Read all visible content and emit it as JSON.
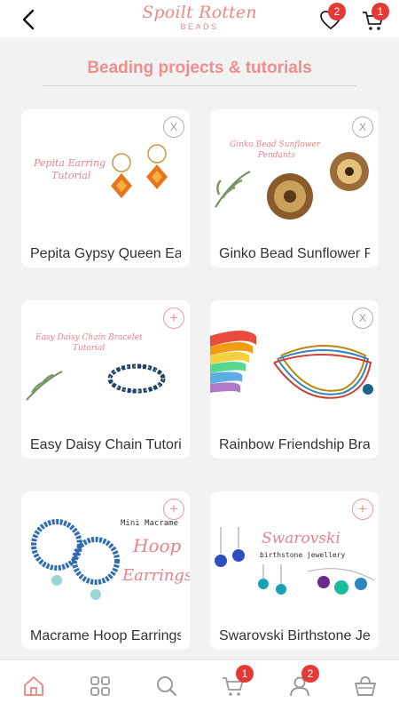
{
  "header": {
    "logo_line1": "Spoilt Rotten",
    "logo_line2": "BEADS",
    "wishlist_count": "2",
    "cart_count": "1"
  },
  "page_title": "Beading projects & tutorials",
  "cards": [
    {
      "name": "Pepita Gypsy Queen Earrings",
      "corner": "X",
      "img_text": [
        "Pepita Earring",
        "Tutorial"
      ]
    },
    {
      "name": "Ginko Bead Sunflower Pendants",
      "corner": "X",
      "img_text": [
        "Ginko Bead Sunflower",
        "Pendants"
      ]
    },
    {
      "name": "Easy Daisy Chain Tutorial",
      "corner": "+",
      "img_text": [
        "Easy Daisy Chain Bracelet",
        "Tutorial"
      ]
    },
    {
      "name": "Rainbow Friendship Bracelet",
      "corner": "X",
      "img_text": []
    },
    {
      "name": "Macrame Hoop Earrings",
      "corner": "+",
      "img_text": [
        "Mini Macrame",
        "Hoop",
        "Earrings"
      ]
    },
    {
      "name": "Swarovski Birthstone Jewellery",
      "corner": "+",
      "img_text": [
        "Swarovski",
        "birthstone jewellery"
      ]
    }
  ],
  "bottom_nav": {
    "items": [
      "home-icon",
      "grid-icon",
      "search-icon",
      "cart-icon",
      "user-icon",
      "basket-icon"
    ],
    "cart_count": "1",
    "user_count": "2"
  },
  "colors": {
    "accent": "#ef8e8e",
    "badge": "#e53935"
  }
}
